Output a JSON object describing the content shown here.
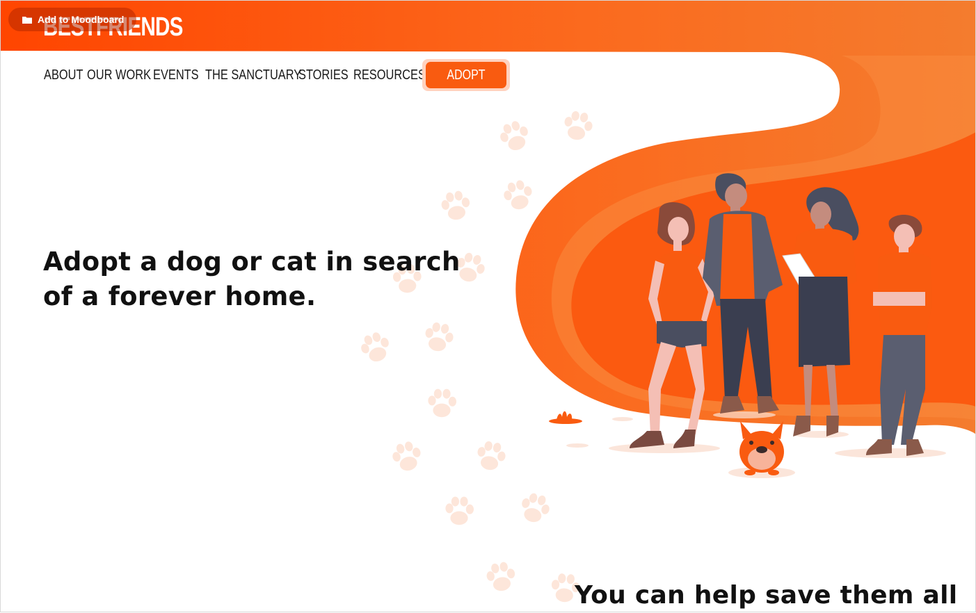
{
  "moodboard": {
    "label": "Add to Moodboard",
    "icon": "folder-icon"
  },
  "logo": {
    "text": "BESTFRIENDS"
  },
  "nav": {
    "items": [
      {
        "label": "ABOUT"
      },
      {
        "label": "OUR WORK"
      },
      {
        "label": "EVENTS"
      },
      {
        "label": "THE SANCTUARY"
      },
      {
        "label": "STORIES"
      },
      {
        "label": "RESOURCES"
      }
    ],
    "cta": "ADOPT"
  },
  "hero": {
    "title": "Adopt a dog or cat in search of a forever home."
  },
  "section2": {
    "title": "You can help save them all"
  },
  "illustration": {
    "icon": "people-with-dog-illustration"
  },
  "decor": {
    "icon": "paw-print-icon"
  },
  "colors": {
    "brand_orange": "#f95b10",
    "header_orange": "#ff4a00",
    "light_orange": "#f7843a",
    "paw_tint": "#fde6da",
    "text_dark": "#111111"
  }
}
